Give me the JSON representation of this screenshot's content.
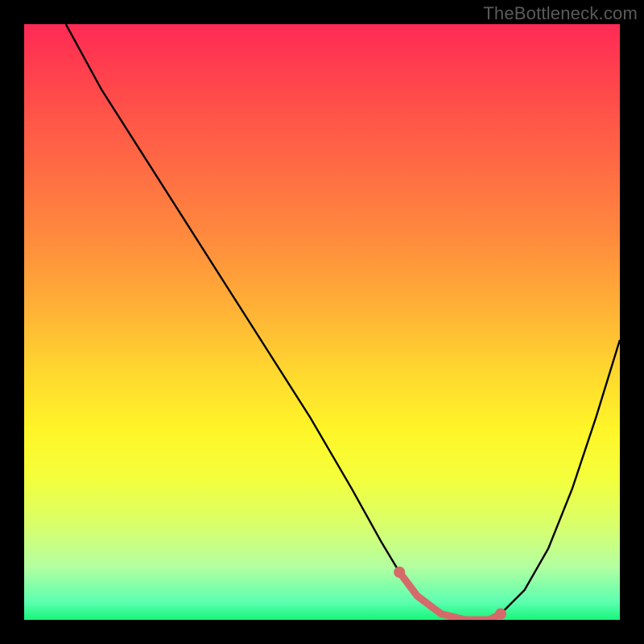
{
  "watermark": "TheBottleneck.com",
  "chart_data": {
    "type": "line",
    "title": "",
    "xlabel": "",
    "ylabel": "",
    "xlim": [
      0,
      100
    ],
    "ylim": [
      0,
      100
    ],
    "series": [
      {
        "name": "bottleneck-curve",
        "color": "#000000",
        "x": [
          7,
          13,
          20,
          27,
          34,
          41,
          48,
          55,
          60,
          63,
          66,
          70,
          74,
          78,
          80,
          84,
          88,
          92,
          96,
          100
        ],
        "values": [
          100,
          89,
          78,
          67,
          56,
          45,
          34,
          22,
          13,
          8,
          4,
          1,
          0,
          0,
          1,
          5,
          12,
          22,
          34,
          47
        ]
      },
      {
        "name": "highlight-band",
        "color": "#d46a6a",
        "x": [
          63,
          66,
          70,
          74,
          78,
          80
        ],
        "values": [
          8,
          4,
          1,
          0,
          0,
          1
        ]
      }
    ],
    "highlight_endpoints": {
      "left": {
        "x": 63,
        "y": 8
      },
      "right": {
        "x": 80,
        "y": 1
      }
    }
  }
}
